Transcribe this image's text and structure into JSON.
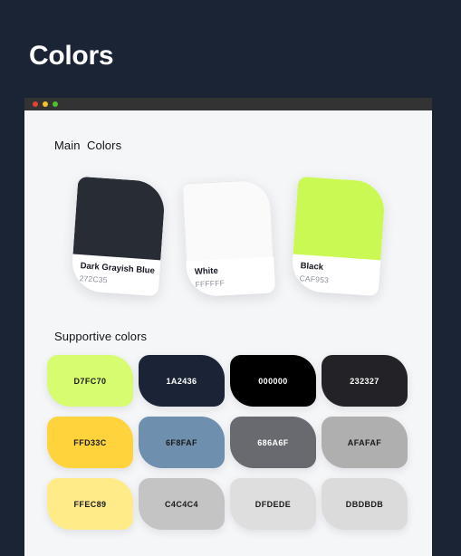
{
  "page": {
    "title": "Colors",
    "background_color": "#1B2435",
    "title_color": "#FFFFFF"
  },
  "window": {
    "titlebar_color": "#333333",
    "body_color": "#F5F6F8",
    "traffic_lights": [
      {
        "name": "close",
        "color": "#E44234"
      },
      {
        "name": "minimize",
        "color": "#F5C02B"
      },
      {
        "name": "maximize",
        "color": "#4FC02C"
      }
    ]
  },
  "main_section": {
    "heading": "Main  Colors",
    "cards": [
      {
        "name": "Dark Grayish Blue",
        "hex": "272C35",
        "swatch_color": "#272C35",
        "bordered": false
      },
      {
        "name": "White",
        "hex": "FFFFFF",
        "swatch_color": "#FAFAFA",
        "bordered": true
      },
      {
        "name": "Black",
        "hex": "CAF953",
        "swatch_color": "#CAF953",
        "bordered": false
      }
    ]
  },
  "supportive_section": {
    "heading": "Supportive colors",
    "swatches": [
      {
        "label": "D7FC70",
        "color": "#D7FC70",
        "text_color": "#1A1A1A"
      },
      {
        "label": "1A2436",
        "color": "#1A2436",
        "text_color": "#FFFFFF"
      },
      {
        "label": "000000",
        "color": "#000000",
        "text_color": "#FFFFFF"
      },
      {
        "label": "232327",
        "color": "#232327",
        "text_color": "#FFFFFF"
      },
      {
        "label": "FFD33C",
        "color": "#FFD33C",
        "text_color": "#1A1A1A"
      },
      {
        "label": "6F8FAF",
        "color": "#6F8FAF",
        "text_color": "#1A1A1A"
      },
      {
        "label": "686A6F",
        "color": "#686A6F",
        "text_color": "#FFFFFF"
      },
      {
        "label": "AFAFAF",
        "color": "#AFAFAF",
        "text_color": "#1A1A1A"
      },
      {
        "label": "FFEC89",
        "color": "#FFEC89",
        "text_color": "#1A1A1A"
      },
      {
        "label": "C4C4C4",
        "color": "#C4C4C4",
        "text_color": "#1A1A1A"
      },
      {
        "label": "DFDEDE",
        "color": "#DFDEDE",
        "text_color": "#1A1A1A"
      },
      {
        "label": "DBDBDB",
        "color": "#DBDBDB",
        "text_color": "#1A1A1A"
      }
    ]
  }
}
